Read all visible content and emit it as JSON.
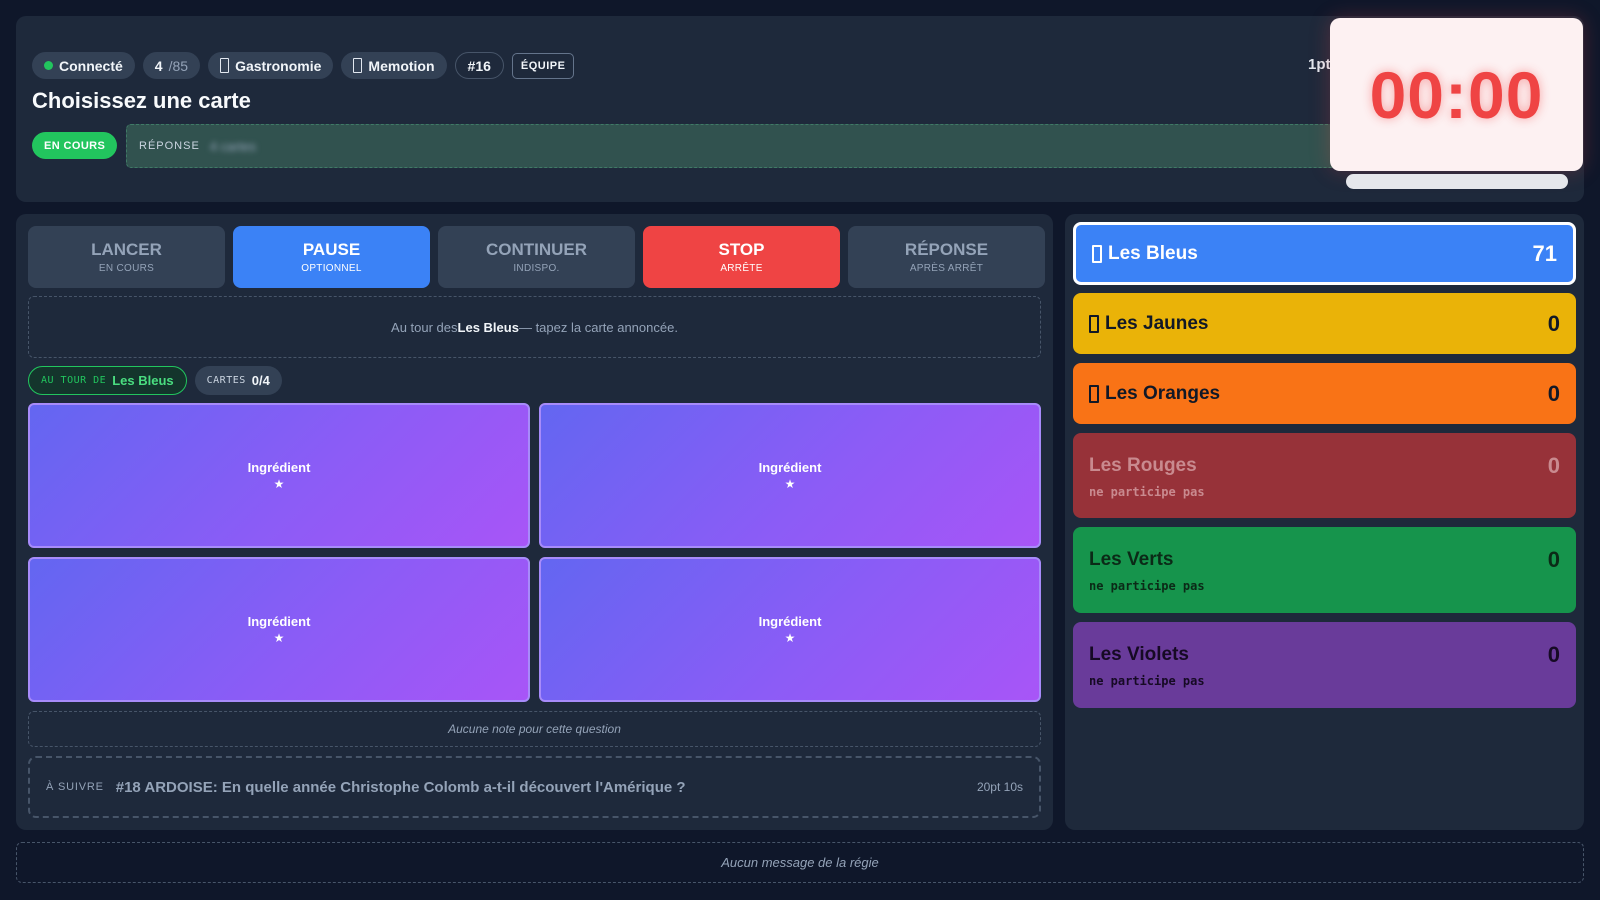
{
  "header": {
    "connection": {
      "label": "Connecté",
      "status_color": "#22c55e"
    },
    "progress": {
      "current": "4",
      "total": "/85"
    },
    "category": {
      "label": "Gastronomie",
      "icon": "category-icon"
    },
    "game_mode": {
      "label": "Memotion",
      "icon": "game-mode-icon"
    },
    "question_number": "#16",
    "mode_badge": "ÉQUIPE",
    "title": "Choisissez une carte",
    "status": "EN COURS",
    "answer_label": "RÉPONSE",
    "answer_value": "4 cartes",
    "points_peek": "1pt",
    "timer": "00:00"
  },
  "controls": [
    {
      "label": "LANCER",
      "sub": "EN COURS"
    },
    {
      "label": "PAUSE",
      "sub": "OPTIONNEL"
    },
    {
      "label": "CONTINUER",
      "sub": "INDISPO."
    },
    {
      "label": "STOP",
      "sub": "ARRÊTE"
    },
    {
      "label": "RÉPONSE",
      "sub": "APRÈS ARRÊT"
    }
  ],
  "turn_message": {
    "prefix": "Au tour des",
    "team": "Les Bleus",
    "suffix": "— tapez la carte annoncée."
  },
  "tags": {
    "turn_key": "AU TOUR DE",
    "turn_value": "Les Bleus",
    "cards_key": "CARTES",
    "cards_value": "0/4"
  },
  "cards": [
    {
      "title": "Ingrédient",
      "symbol": "★"
    },
    {
      "title": "Ingrédient",
      "symbol": "★"
    },
    {
      "title": "Ingrédient",
      "symbol": "★"
    },
    {
      "title": "Ingrédient",
      "symbol": "★"
    }
  ],
  "note": "Aucune note pour cette question",
  "next": {
    "label": "À SUIVRE",
    "question": "#18 ARDOISE: En quelle année Christophe Colomb a-t-il découvert l'Amérique ?",
    "meta": "20pt 10s"
  },
  "teams": [
    {
      "name": "Les Bleus",
      "score": "71",
      "color": "#3b82f6",
      "active": true,
      "icon": "team-icon"
    },
    {
      "name": "Les Jaunes",
      "score": "0",
      "color": "#eab308",
      "icon": "team-icon"
    },
    {
      "name": "Les Oranges",
      "score": "0",
      "color": "#f97316",
      "icon": "team-icon"
    },
    {
      "name": "Les Rouges",
      "score": "0",
      "color": "#973239",
      "note": "ne participe pas"
    },
    {
      "name": "Les Verts",
      "score": "0",
      "color": "#16944c",
      "note": "ne participe pas"
    },
    {
      "name": "Les Violets",
      "score": "0",
      "color": "#693b9a",
      "note": "ne participe pas"
    }
  ],
  "footer": "Aucun message de la régie"
}
